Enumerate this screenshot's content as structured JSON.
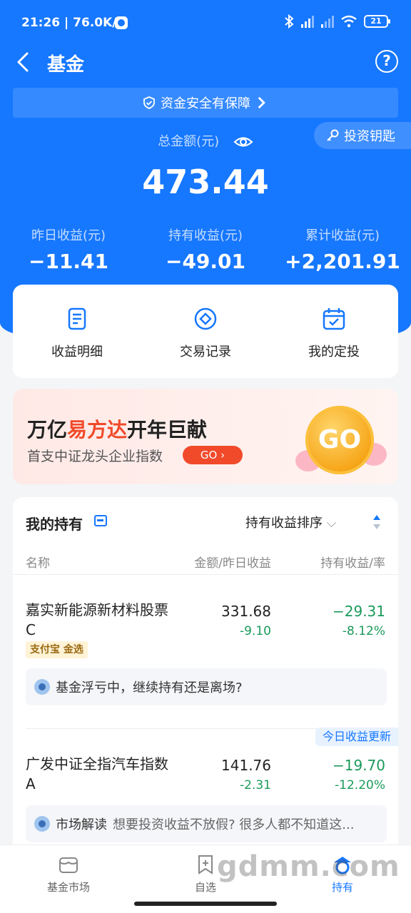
{
  "status_bar": {
    "time": "21:26",
    "network_speed": "76.0K/s",
    "battery": "21"
  },
  "nav": {
    "title": "基金",
    "help": "?"
  },
  "safety_banner": "资金安全有保障",
  "key_button": "投资钥匙",
  "total": {
    "label": "总金额(元)",
    "value": "473.44"
  },
  "stats": [
    {
      "label": "昨日收益(元)",
      "value": "−11.41"
    },
    {
      "label": "持有收益(元)",
      "value": "−49.01"
    },
    {
      "label": "累计收益(元)",
      "value": "+2,201.91"
    }
  ],
  "quick_actions": [
    {
      "label": "收益明细",
      "icon": "document-icon"
    },
    {
      "label": "交易记录",
      "icon": "exchange-icon"
    },
    {
      "label": "我的定投",
      "icon": "calendar-check-icon"
    }
  ],
  "promo": {
    "headline_pre": "万亿",
    "headline_highlight": "易方达",
    "headline_post": "开年巨献",
    "subtitle": "首支中证龙头企业指数",
    "pill": "GO",
    "coin": "GO"
  },
  "holdings": {
    "title": "我的持有",
    "sort_label": "持有收益排序",
    "columns": {
      "name": "名称",
      "amount": "金额/昨日收益",
      "profit": "持有收益/率"
    },
    "funds": [
      {
        "name": "嘉实新能源新材料股票C",
        "tag": "支付宝 金选",
        "amount": "331.68",
        "day_profit": "-9.10",
        "hold_profit": "−29.31",
        "hold_rate": "-8.12%",
        "tip_title": "基金浮亏中，继续持有还是离场?",
        "tip_sub": ""
      },
      {
        "name": "广发中证全指汽车指数A",
        "tag": "",
        "amount": "141.76",
        "day_profit": "-2.31",
        "hold_profit": "−19.70",
        "hold_rate": "-12.20%",
        "tip_title": "市场解读",
        "tip_sub": "想要投资收益不放假? 很多人都不知道这..."
      }
    ],
    "update_badge": "今日收益更新"
  },
  "tabbar": [
    {
      "label": "基金市场",
      "icon": "market-icon",
      "active": false
    },
    {
      "label": "自选",
      "icon": "add-favorite-icon",
      "active": false
    },
    {
      "label": "持有",
      "icon": "holdings-icon",
      "active": true
    }
  ],
  "watermark": "gdmm.com",
  "colors": {
    "brand_blue": "#1677ff",
    "loss_green": "#1a9a5a",
    "promo_red": "#f04a2a"
  }
}
